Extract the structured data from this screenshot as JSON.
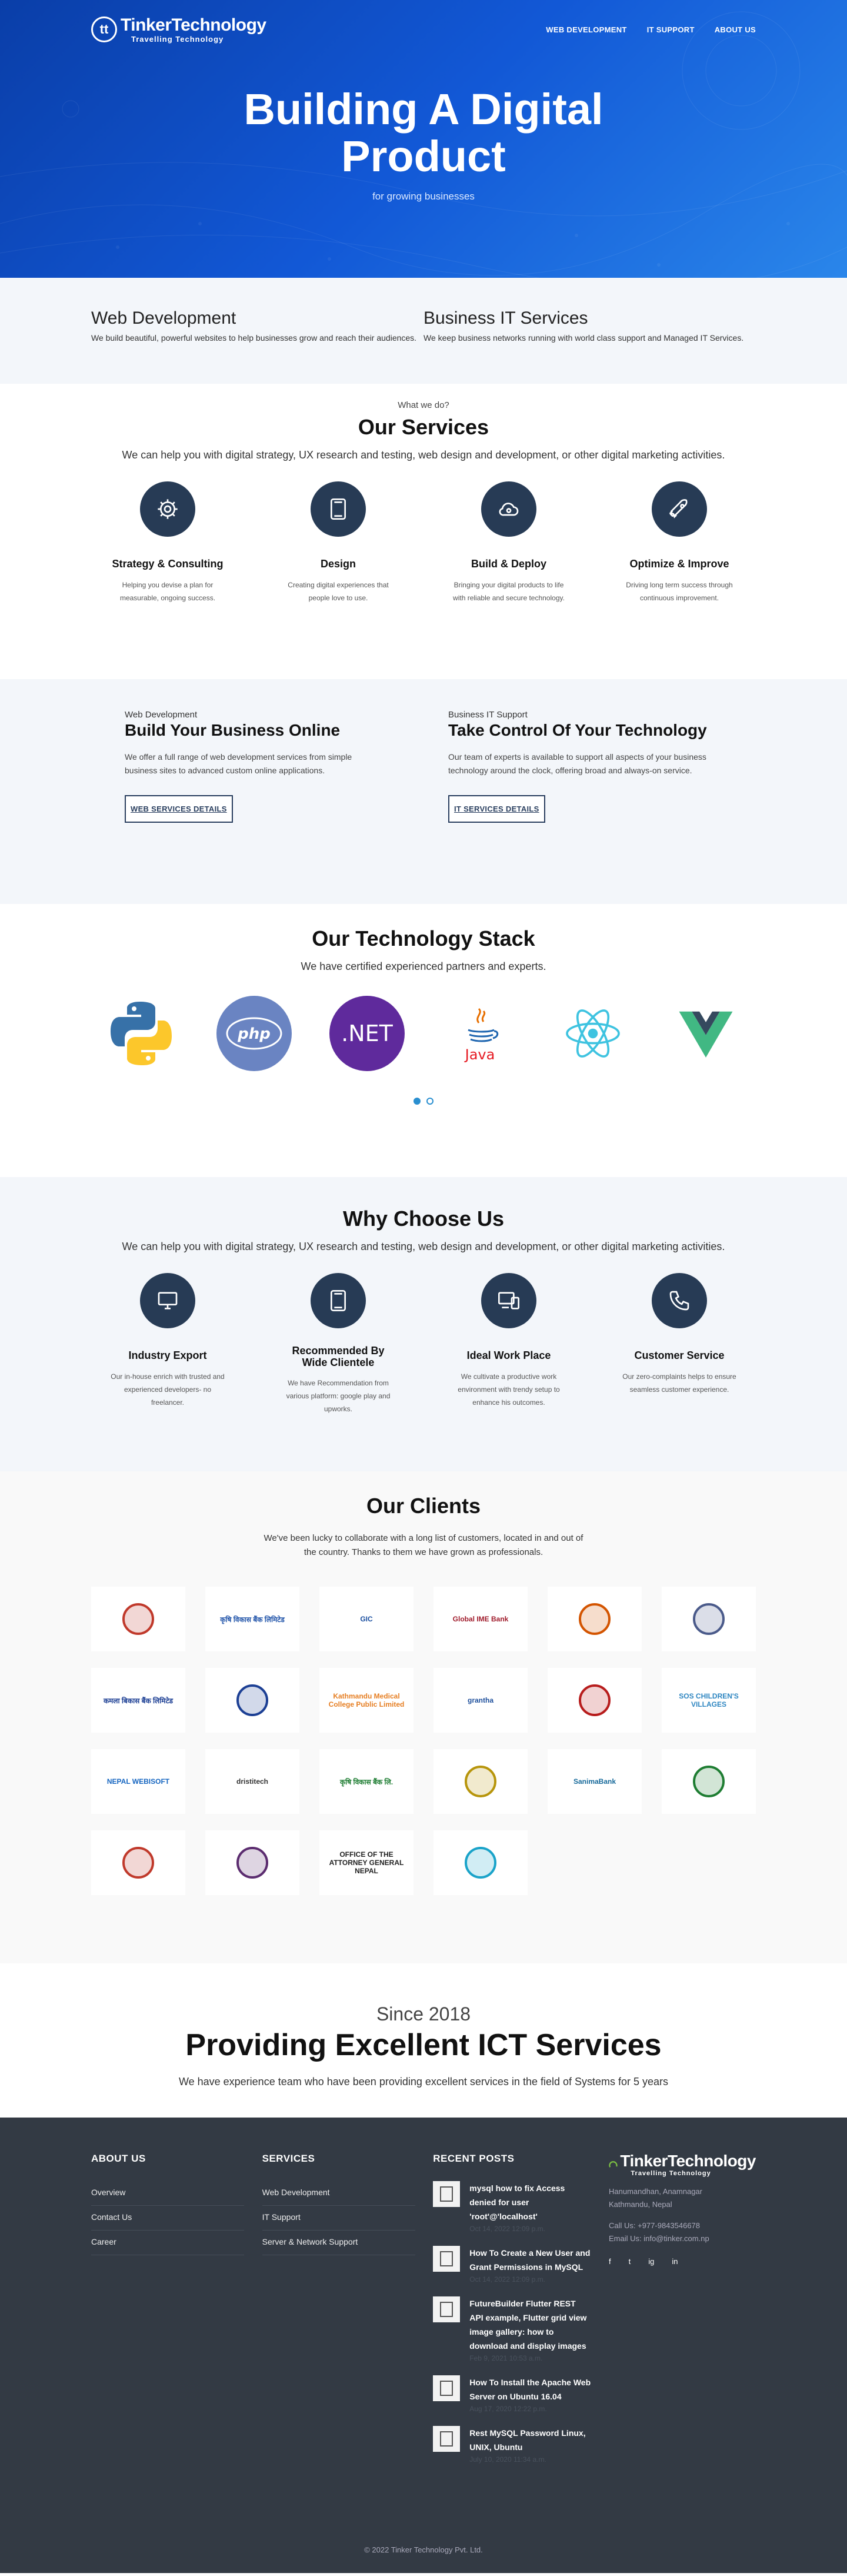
{
  "header": {
    "logo_name": "TinkerTechnology",
    "logo_tagline": "Travelling Technology",
    "logo_mark": "tt",
    "nav": [
      "WEB DEVELOPMENT",
      "IT SUPPORT",
      "ABOUT US"
    ]
  },
  "hero": {
    "title_line1": "Building A Digital",
    "title_line2": "Product",
    "subtitle": "for growing businesses"
  },
  "intro": [
    {
      "title": "Web Development",
      "text": "We build beautiful, powerful websites to help businesses grow and reach their audiences."
    },
    {
      "title": "Business IT Services",
      "text": "We keep business networks running with world class support and Managed IT Services."
    }
  ],
  "services": {
    "kicker": "What we do?",
    "title": "Our Services",
    "lead": "We can help you with digital strategy, UX research and testing, web design and development, or other digital marketing activities.",
    "items": [
      {
        "icon": "gear-icon",
        "title": "Strategy & Consulting",
        "text": "Helping you devise a plan for measurable, ongoing success."
      },
      {
        "icon": "tablet-icon",
        "title": "Design",
        "text": "Creating digital experiences that people love to use."
      },
      {
        "icon": "cloud-deploy-icon",
        "title": "Build & Deploy",
        "text": "Bringing your digital products to life with reliable and secure technology."
      },
      {
        "icon": "rocket-icon",
        "title": "Optimize & Improve",
        "text": "Driving long term success through continuous improvement."
      }
    ]
  },
  "details": [
    {
      "kicker": "Web Development",
      "title": "Build Your Business Online",
      "text": "We offer a full range of web development services from simple business sites to advanced custom online applications.",
      "button": "WEB SERVICES DETAILS"
    },
    {
      "kicker": "Business IT Support",
      "title": "Take Control Of Your Technology",
      "text": "Our team of experts is available to support all aspects of your business technology around the clock, offering broad and always-on service.",
      "button": "IT SERVICES DETAILS"
    }
  ],
  "tech": {
    "title": "Our Technology Stack",
    "lead": "We have certified experienced partners and experts.",
    "items": [
      {
        "name": "python-logo",
        "label": ""
      },
      {
        "name": "php-logo",
        "label": "php"
      },
      {
        "name": "dotnet-logo",
        "label": ".NET"
      },
      {
        "name": "java-logo",
        "label": "Java"
      },
      {
        "name": "react-logo",
        "label": ""
      },
      {
        "name": "vue-logo",
        "label": ""
      }
    ],
    "carousel_active": 1,
    "carousel_count": 2
  },
  "why": {
    "title": "Why Choose Us",
    "lead": "We can help you with digital strategy, UX research and testing, web design and development, or other digital marketing activities.",
    "items": [
      {
        "icon": "monitor-icon",
        "title": "Industry Export",
        "text": "Our in-house enrich with trusted and experienced developers- no freelancer."
      },
      {
        "icon": "tablet-icon",
        "title": "Recommended By Wide Clientele",
        "text": "We have Recommendation from various platform: google play and upworks."
      },
      {
        "icon": "devices-icon",
        "title": "Ideal Work Place",
        "text": "We cultivate a productive work environment with trendy setup to enhance his outcomes."
      },
      {
        "icon": "phone-icon",
        "title": "Customer Service",
        "text": "Our zero-complaints helps to ensure seamless customer experience."
      }
    ]
  },
  "clients": {
    "title": "Our Clients",
    "lead_line1": "We've been lucky to collaborate with a long list of customers, located in and out of",
    "lead_line2": "the country. Thanks to them we have grown as professionals.",
    "logos": [
      {
        "name": "nepal-government-emblem",
        "label": "",
        "color": "#c0392b"
      },
      {
        "name": "krishi-bikas-bank-logo",
        "label": "कृषि विकास बैंक लिमिटेड",
        "color": "#2255aa"
      },
      {
        "name": "gic-logo",
        "label": "GIC",
        "color": "#1a4fa0"
      },
      {
        "name": "global-ime-bank-logo",
        "label": "Global IME Bank",
        "color": "#a01c2c"
      },
      {
        "name": "emblem-logo-orange",
        "label": "",
        "color": "#d35400"
      },
      {
        "name": "emblem-logo-diamond",
        "label": "",
        "color": "#4a5a8a"
      },
      {
        "name": "kamala-bikas-bank-logo",
        "label": "कमला बिकास बैंक लिमिटेड",
        "color": "#1c3f94"
      },
      {
        "name": "bank-logo-blue-text",
        "label": "",
        "color": "#1c3f94"
      },
      {
        "name": "kathmandu-medical-college-logo",
        "label": "Kathmandu Medical College Public Limited",
        "color": "#e67e22"
      },
      {
        "name": "grantha-logo",
        "label": "grantha",
        "color": "#1d4f9c"
      },
      {
        "name": "bank-logo-red-text",
        "label": "",
        "color": "#b71c1c"
      },
      {
        "name": "sos-childrens-villages-logo",
        "label": "SOS CHILDREN'S VILLAGES",
        "color": "#2e86c1"
      },
      {
        "name": "nepal-webisoft-logo",
        "label": "NEPAL WEBISOFT",
        "color": "#1565c0"
      },
      {
        "name": "dristitech-logo",
        "label": "dristitech",
        "color": "#333333"
      },
      {
        "name": "krishi-development-bank-logo",
        "label": "कृषि विकास बैंक लि.",
        "color": "#1e7d32"
      },
      {
        "name": "emblem-logo-yellow",
        "label": "",
        "color": "#b7950b"
      },
      {
        "name": "sanima-bank-logo",
        "label": "SanimaBank",
        "color": "#16699a"
      },
      {
        "name": "bank-logo-green-text",
        "label": "",
        "color": "#1e7d32"
      },
      {
        "name": "nepal-government-seal-logo",
        "label": "",
        "color": "#c0392b"
      },
      {
        "name": "purple-leaf-logo",
        "label": "",
        "color": "#5b2c6f"
      },
      {
        "name": "attorney-general-seal-logo",
        "label": "OFFICE OF THE ATTORNEY GENERAL NEPAL",
        "color": "#222222"
      },
      {
        "name": "water-drop-logo",
        "label": "",
        "color": "#1aa3c9"
      }
    ]
  },
  "since": {
    "kicker": "Since 2018",
    "title": "Providing Excellent ICT Services",
    "text": "We have experience team who have been providing excellent services in the field of Systems for 5 years"
  },
  "footer": {
    "about_title": "ABOUT US",
    "about_links": [
      "Overview",
      "Contact Us",
      "Career"
    ],
    "services_title": "SERVICES",
    "services_links": [
      "Web Development",
      "IT Support",
      "Server & Network Support"
    ],
    "posts_title": "RECENT POSTS",
    "posts": [
      {
        "title": "mysql how to fix Access denied for user 'root'@'localhost'",
        "date": "Oct 14, 2022 12:09 p.m."
      },
      {
        "title": "How To Create a New User and Grant Permissions in MySQL",
        "date": "Oct 14, 2022 12:09 p.m."
      },
      {
        "title": "FutureBuilder Flutter REST API example, Flutter grid view image gallery: how to download and display images",
        "date": "Feb 9, 2021 10:53 a.m."
      },
      {
        "title": "How To Install the Apache Web Server on Ubuntu 16.04",
        "date": "Aug 17, 2020 12:22 p.m."
      },
      {
        "title": "Rest MySQL Password Linux, UNIX, Ubuntu",
        "date": "July 10, 2020 11:34 a.m."
      }
    ],
    "address_line1": "Hanumandhan, Anamnagar",
    "address_line2": "Kathmandu, Nepal",
    "call": "Call Us: +977-9843546678",
    "email": "Email Us: info@tinker.com.np",
    "social": [
      "f",
      "t",
      "ig",
      "in"
    ],
    "copyright": "© 2022 Tinker Technology Pvt. Ltd."
  }
}
